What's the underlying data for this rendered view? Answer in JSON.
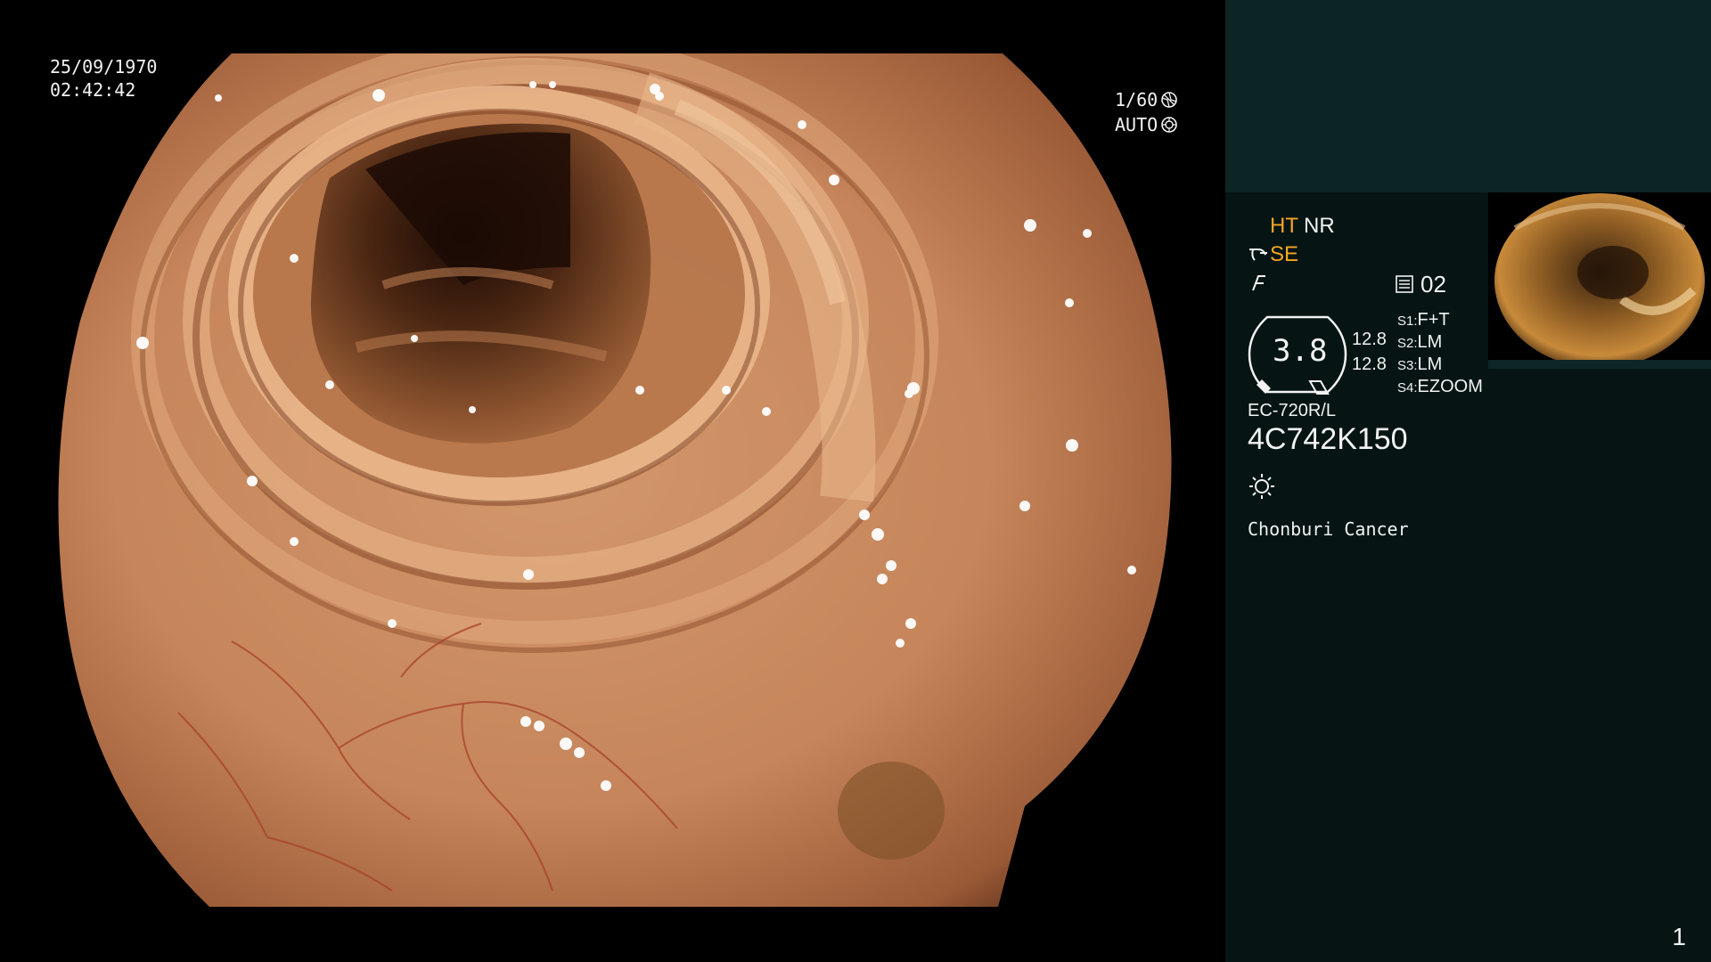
{
  "overlay": {
    "date": "25/09/1970",
    "time": "02:42:42",
    "shutter": "1/60",
    "iris": "AUTO"
  },
  "info": {
    "ht_label": "HT",
    "nr_label": "NR",
    "se_label": "SE",
    "memo_value": "02",
    "magnification": "3.8",
    "zoom_values": [
      "12.8",
      "12.8"
    ],
    "presets": [
      {
        "key": "S1",
        "value": "F+T"
      },
      {
        "key": "S2",
        "value": "LM"
      },
      {
        "key": "S3",
        "value": "LM"
      },
      {
        "key": "S4",
        "value": "EZOOM"
      }
    ],
    "scope_model": "EC-720R/L",
    "scope_serial": "4C742K150",
    "institution": "Chonburi Cancer"
  },
  "page_number": "1",
  "colors": {
    "accent_orange": "#f5a623",
    "panel_bg": "#061414",
    "panel_top_bg": "#0c2424"
  },
  "icons": {
    "shutter": "shutter-icon",
    "iris": "iris-icon",
    "scope": "scope-tip-icon",
    "structure": "structure-icon",
    "memo": "memo-icon",
    "light": "light-source-icon"
  }
}
